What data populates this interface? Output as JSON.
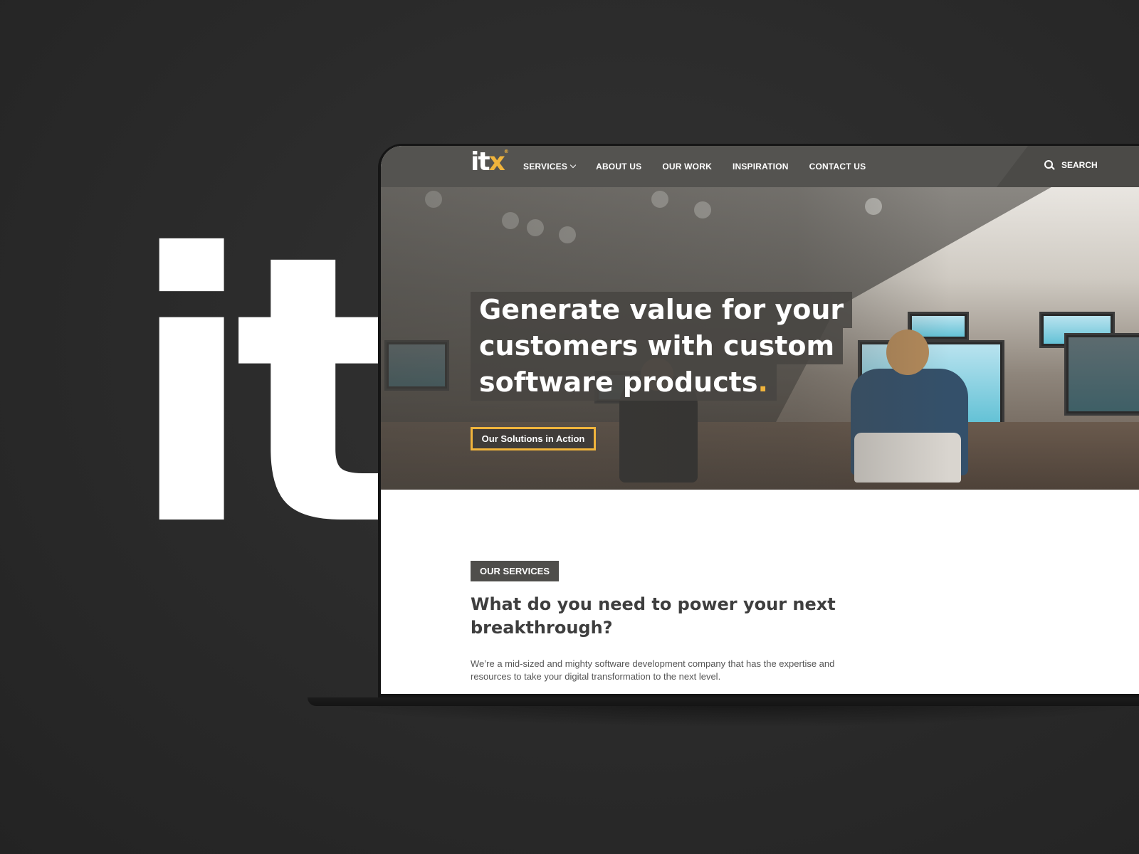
{
  "brand": {
    "logo_text_main": "it",
    "logo_text_accent": "x",
    "logo_mark": "®",
    "background_logo": "itx",
    "accent_color": "#f0b43c"
  },
  "nav": {
    "items": [
      {
        "label": "SERVICES",
        "has_dropdown": true
      },
      {
        "label": "ABOUT US"
      },
      {
        "label": "OUR WORK"
      },
      {
        "label": "INSPIRATION"
      },
      {
        "label": "CONTACT US"
      }
    ],
    "search": {
      "label": "SEARCH",
      "icon": "search-icon"
    }
  },
  "hero": {
    "headline_lines": [
      "Generate value for your",
      "customers with custom",
      "software products"
    ],
    "headline_end_punct": ".",
    "cta_label": "Our Solutions in Action"
  },
  "services": {
    "badge": "OUR SERVICES",
    "title": "What do you need to power your next breakthrough?",
    "text": "We’re a mid-sized and mighty software development company that has the expertise and resources to take your digital transformation to the next level."
  }
}
